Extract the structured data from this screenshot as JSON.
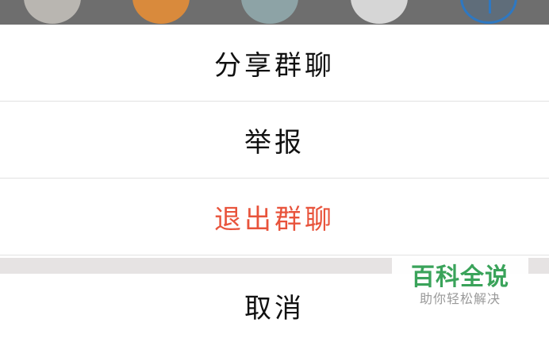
{
  "group_members": {
    "avatars": [
      "member-avatar",
      "tiger-avatar",
      "photo-avatar",
      "sketch-avatar"
    ],
    "add_icon": "plus-icon"
  },
  "action_sheet": {
    "share_label": "分享群聊",
    "report_label": "举报",
    "exit_label": "退出群聊",
    "exit_color": "#e8533b",
    "cancel_label": "取消"
  },
  "watermark": {
    "title": "百科全说",
    "subtitle": "助你轻松解决"
  }
}
